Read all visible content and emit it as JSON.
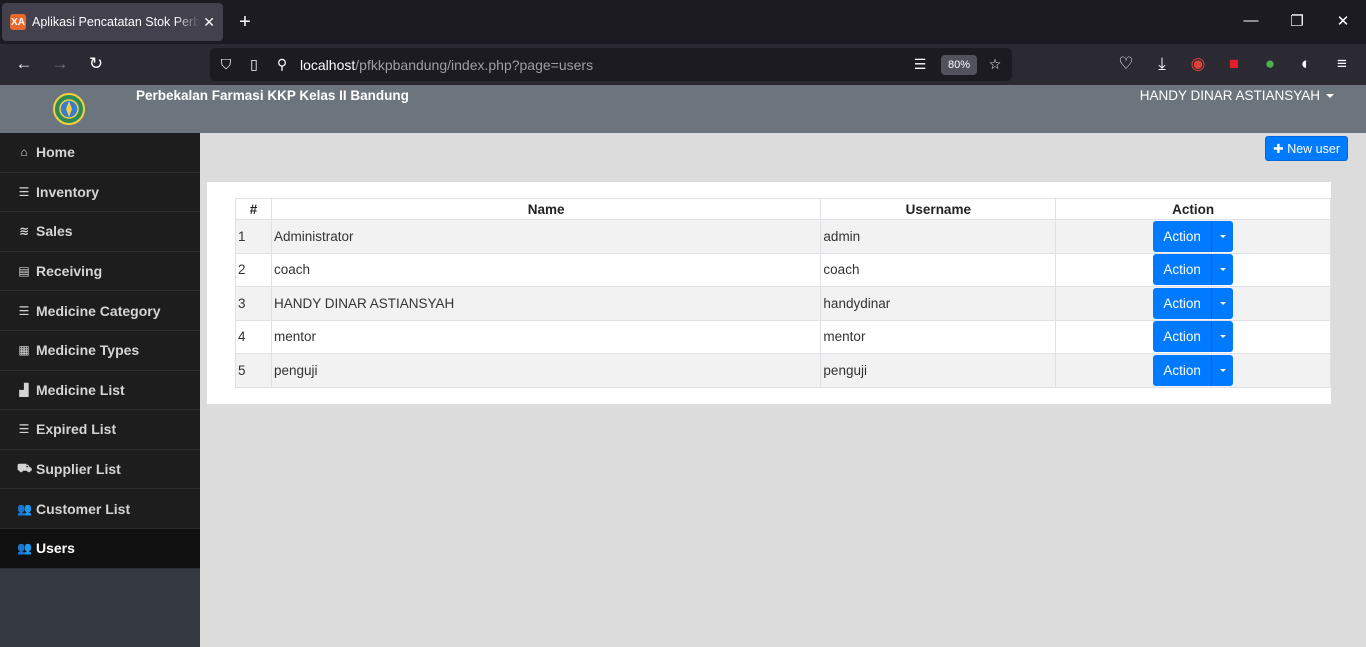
{
  "browser": {
    "tab_title": "Aplikasi Pencatatan Stok Perbekalan Farmasi",
    "favicon_text": "XA",
    "url_host": "localhost",
    "url_path": "/pfkkpbandung/index.php?page=users",
    "zoom": "80%"
  },
  "app": {
    "brand": "Perbekalan Farmasi KKP Kelas II Bandung",
    "user": "HANDY DINAR ASTIANSYAH"
  },
  "sidebar": {
    "items": [
      {
        "label": "Home",
        "icon": "home-icon"
      },
      {
        "label": "Inventory",
        "icon": "list-icon"
      },
      {
        "label": "Sales",
        "icon": "coins-icon"
      },
      {
        "label": "Receiving",
        "icon": "file-icon"
      },
      {
        "label": "Medicine Category",
        "icon": "list-icon"
      },
      {
        "label": "Medicine Types",
        "icon": "table-icon"
      },
      {
        "label": "Medicine List",
        "icon": "boxes-icon"
      },
      {
        "label": "Expired List",
        "icon": "list-icon"
      },
      {
        "label": "Supplier List",
        "icon": "truck-icon"
      },
      {
        "label": "Customer List",
        "icon": "user-friends-icon"
      },
      {
        "label": "Users",
        "icon": "users-icon"
      }
    ]
  },
  "main": {
    "new_user_label": "New user",
    "table": {
      "headers": [
        "#",
        "Name",
        "Username",
        "Action"
      ],
      "rows": [
        {
          "no": "1",
          "name": "Administrator",
          "username": "admin",
          "action": "Action"
        },
        {
          "no": "2",
          "name": "coach",
          "username": "coach",
          "action": "Action"
        },
        {
          "no": "3",
          "name": "HANDY DINAR ASTIANSYAH",
          "username": "handydinar",
          "action": "Action"
        },
        {
          "no": "4",
          "name": "mentor",
          "username": "mentor",
          "action": "Action"
        },
        {
          "no": "5",
          "name": "penguji",
          "username": "penguji",
          "action": "Action"
        }
      ]
    }
  },
  "colors": {
    "primary": "#007bff",
    "topbar": "#6c757d",
    "sidebar": "#1d1d1d"
  }
}
